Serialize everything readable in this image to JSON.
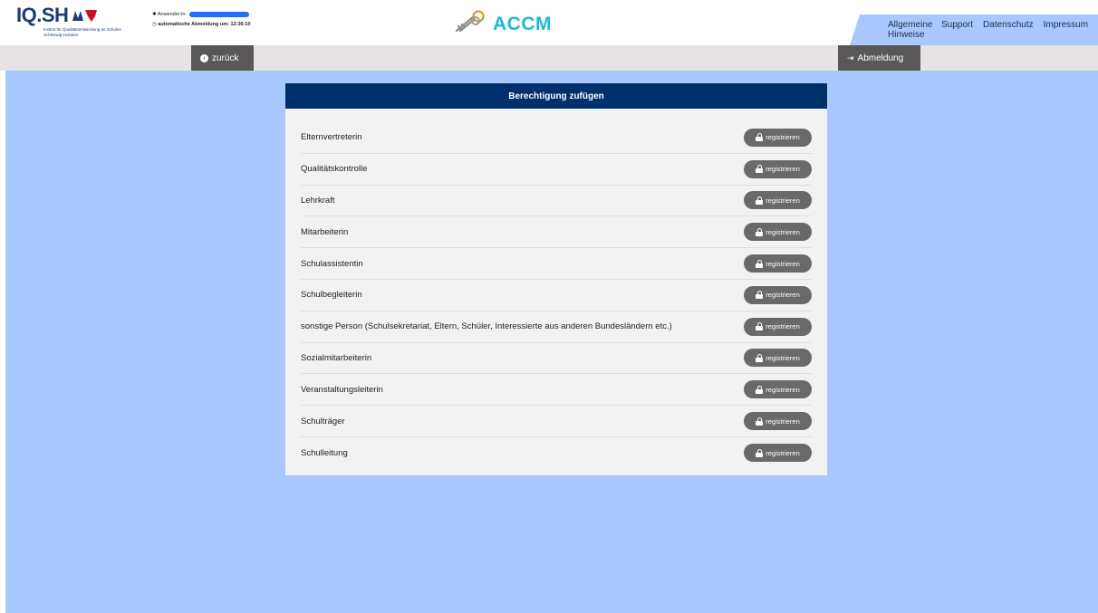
{
  "header": {
    "logo_main": "IQ.SH",
    "logo_subtitle": "Institut für Qualitätsentwicklung an Schulen Schleswig-Holstein",
    "user_label": "Anwender:in:",
    "logout_timer_label": "automatische Abmeldung um: 12:36:10",
    "brand_name": "ACCM",
    "nav": [
      "Allgemeine Hinweise",
      "Support",
      "Datenschutz",
      "Impressum"
    ]
  },
  "toolbar": {
    "back_label": "zurück",
    "logout_label": "Abmeldung"
  },
  "panel": {
    "title": "Berechtigung zufügen",
    "rows": [
      {
        "label": "Elternvertreterin",
        "button": "registrieren"
      },
      {
        "label": "Qualitätskontrolle",
        "button": "registrieren"
      },
      {
        "label": "Lehrkraft",
        "button": "registrieren"
      },
      {
        "label": "Mitarbeiterin",
        "button": "registrieren"
      },
      {
        "label": "Schulassistentin",
        "button": "registrieren"
      },
      {
        "label": "Schulbegleiterin",
        "button": "registrieren"
      },
      {
        "label": "sonstige Person (Schulsekretariat, Eltern, Schüler, Interessierte aus anderen Bundesländern etc.)",
        "button": "registrieren"
      },
      {
        "label": "Sozialmitarbeiterin",
        "button": "registrieren"
      },
      {
        "label": "Veranstaltungsleiterin",
        "button": "registrieren"
      },
      {
        "label": "Schulträger",
        "button": "registrieren"
      },
      {
        "label": "Schulleitung",
        "button": "registrieren"
      }
    ]
  },
  "colors": {
    "content_bg": "#a9c8ff",
    "panel_header": "#00306b",
    "button_bg": "#6b6868",
    "brand": "#22b7d8"
  }
}
